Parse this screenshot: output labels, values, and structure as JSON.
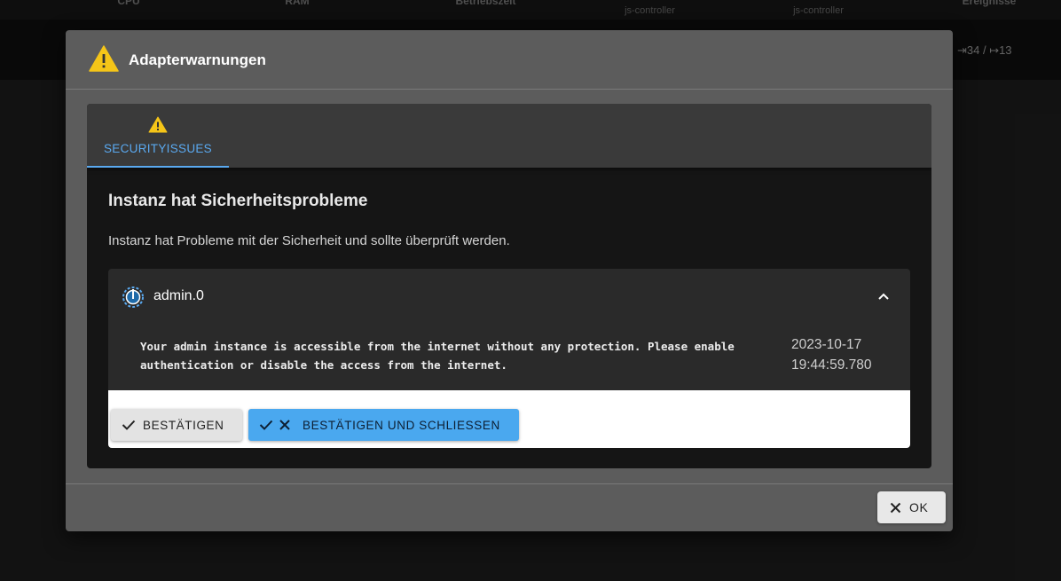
{
  "background": {
    "columns": [
      {
        "label": "CPU",
        "sub": ""
      },
      {
        "label": "RAM",
        "sub": ""
      },
      {
        "label": "Betriebszeit",
        "sub": ""
      },
      {
        "label": "",
        "sub": "js-controller"
      },
      {
        "label": "",
        "sub": "js-controller"
      },
      {
        "label": "Ereignisse",
        "sub": ""
      }
    ],
    "event_counter": "⇥34 / ↦13"
  },
  "dialog": {
    "title": "Adapterwarnungen",
    "tabs": [
      {
        "label": "SECURITYISSUES",
        "icon": "warning-icon",
        "active": true
      }
    ],
    "section_title": "Instanz hat Sicherheitsprobleme",
    "section_description": "Instanz hat Probleme mit der Sicherheit und sollte überprüft werden.",
    "instance": {
      "name": "admin.0",
      "icon": "admin-adapter-icon",
      "expanded": true,
      "message": "Your admin instance is accessible from the internet without any protection. Please enable authentication or disable the access from the internet.",
      "date": "2023-10-17",
      "time": "19:44:59.780"
    },
    "buttons": {
      "confirm": "BESTÄTIGEN",
      "confirm_close": "BESTÄTIGEN UND SCHLIESSEN",
      "ok": "OK"
    }
  },
  "colors": {
    "accent": "#5aa9f0",
    "warning": "#f5c518",
    "primary_button": "#4aa8ef"
  }
}
